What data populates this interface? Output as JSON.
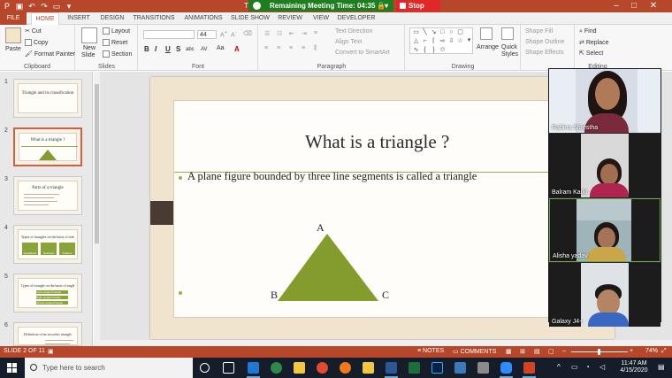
{
  "meeting_bar": {
    "label": "Remaining Meeting Time: 04:35"
  },
  "stop_share": {
    "label": "Stop Share"
  },
  "doc_title_fragment": "T",
  "window_controls": {
    "minimize": "–",
    "restore": "□",
    "close": "✕"
  },
  "ribbon_tabs": [
    "FILE",
    "HOME",
    "INSERT",
    "DESIGN",
    "TRANSITIONS",
    "ANIMATIONS",
    "SLIDE SHOW",
    "REVIEW",
    "VIEW",
    "DEVELOPER"
  ],
  "active_tab": "HOME",
  "clipboard": {
    "paste": "Paste",
    "cut": "Cut",
    "copy": "Copy",
    "format_painter": "Format Painter",
    "group": "Clipboard"
  },
  "slides_group": {
    "new_slide": "New",
    "new_slide_2": "Slide",
    "layout": "Layout",
    "reset": "Reset",
    "section": "Section",
    "group": "Slides"
  },
  "font_group": {
    "font_size": "44",
    "group": "Font",
    "bold": "B",
    "italic": "I",
    "underline": "U",
    "strike": "S",
    "shadow": "abc",
    "spacing": "AV",
    "case": "Aa",
    "color": "A"
  },
  "paragraph_group": {
    "text_direction": "Text Direction",
    "align_text": "Align Text",
    "smartart": "Convert to SmartArt",
    "group": "Paragraph"
  },
  "drawing_group": {
    "arrange": "Arrange",
    "quick_styles_1": "Quick",
    "quick_styles_2": "Styles",
    "shape_fill": "Shape Fill",
    "shape_outline": "Shape Outline",
    "shape_effects": "Shape Effects",
    "group": "Drawing"
  },
  "editing_group": {
    "find": "Find",
    "replace": "Replace",
    "select": "Select",
    "group": "Editing"
  },
  "thumbnails": [
    {
      "num": "1",
      "title": "Triangle and its classification"
    },
    {
      "num": "2",
      "title": "What is a triangle ?"
    },
    {
      "num": "3",
      "title": "Parts of a triangle"
    },
    {
      "num": "4",
      "title": "Types of triangles on the basis of side"
    },
    {
      "num": "5",
      "title": "Types of triangle on the basis of angle"
    },
    {
      "num": "6",
      "title": "Definition of an isosceles triangle"
    }
  ],
  "thumb_labels": {
    "t4": [
      "Equilateral",
      "Isosceles",
      "Scalene"
    ],
    "t5": [
      "Acute angled triangle",
      "Right angled triangle",
      "Obtuse angled triangle"
    ]
  },
  "slide": {
    "title": "What is a triangle ?",
    "bullet": "A plane figure bounded by three line segments is called a triangle",
    "vertex_a": "A",
    "vertex_b": "B",
    "vertex_c": "C",
    "triangle_color": "#849b2e"
  },
  "participants": [
    {
      "name": "Rabina Shrestha"
    },
    {
      "name": "Balram Karki"
    },
    {
      "name": "Alisha yadav"
    },
    {
      "name": "Galaxy J4+"
    }
  ],
  "status": {
    "slide_count": "SLIDE 2 OF 11",
    "notes": "NOTES",
    "comments": "COMMENTS",
    "zoom": "74%"
  },
  "taskbar": {
    "search_placeholder": "Type here to search",
    "time": "11:47 AM",
    "date": "4/15/2020"
  },
  "colors": {
    "accent": "#b7472a",
    "meeting_green": "#1e7d1e",
    "stop_red": "#e02828",
    "slide_bg": "#f1e4cf",
    "rule_green": "#9cb046"
  }
}
